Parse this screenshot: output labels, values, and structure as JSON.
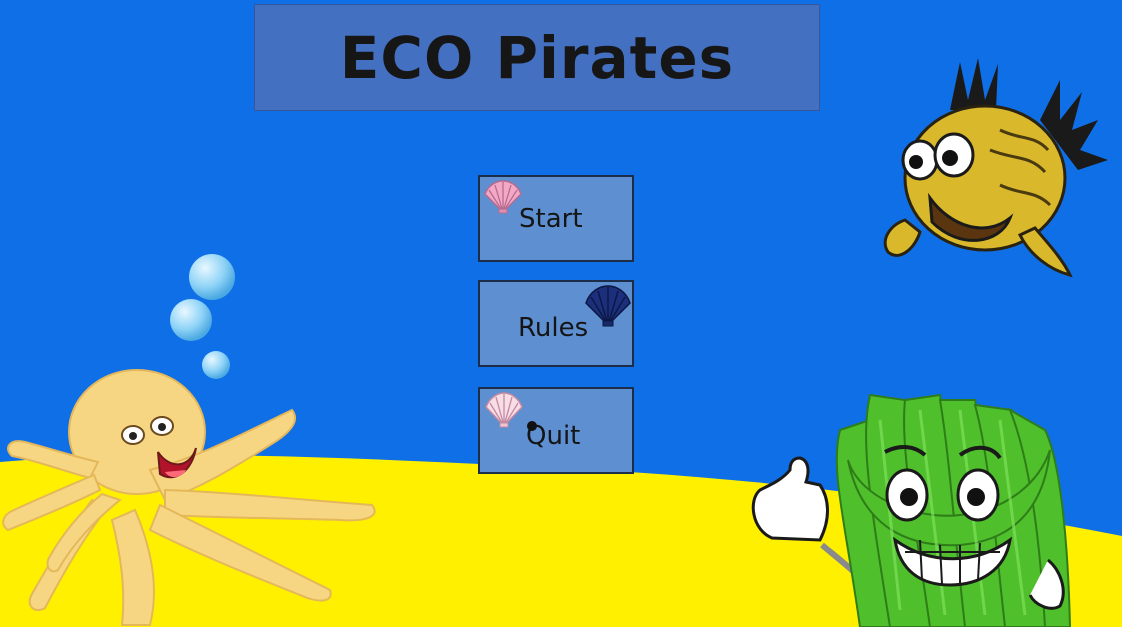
{
  "game": {
    "title": "ECO Pirates"
  },
  "menu": {
    "start_label": "Start",
    "rules_label": "Rules",
    "quit_label": "Quit"
  },
  "colors": {
    "sea": "#0f6fe6",
    "sand": "#fff000",
    "title_banner": "#4470c2",
    "button": "#5d8fd1",
    "octopus": "#f6d27a",
    "fish": "#d8b62a",
    "seaweed": "#4fbf2c",
    "bubble": "#8fd3f7"
  },
  "icons": {
    "start_shell": "pink-scallop-shell-icon",
    "rules_shell": "navy-scallop-shell-icon",
    "quit_shell": "light-scallop-shell-icon",
    "cursor": "mouse-cursor-dot"
  }
}
